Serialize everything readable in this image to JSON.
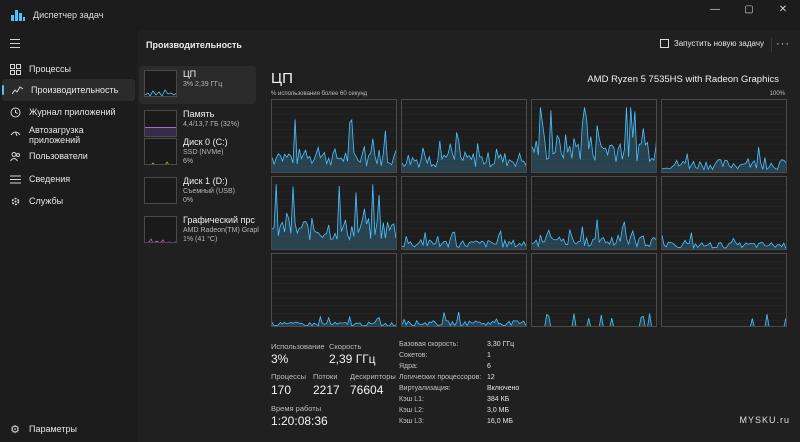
{
  "window": {
    "title": "Диспетчер задач",
    "controls": [
      "—",
      "▢",
      "✕"
    ]
  },
  "nav": {
    "items": [
      {
        "label": "Процессы",
        "icon": "grid-icon"
      },
      {
        "label": "Производительность",
        "icon": "performance-icon"
      },
      {
        "label": "Журнал приложений",
        "icon": "history-icon"
      },
      {
        "label": "Автозагрузка приложений",
        "icon": "startup-icon"
      },
      {
        "label": "Пользователи",
        "icon": "users-icon"
      },
      {
        "label": "Сведения",
        "icon": "details-icon"
      },
      {
        "label": "Службы",
        "icon": "services-icon"
      }
    ],
    "settings_label": "Параметры"
  },
  "header": {
    "title": "Производительность",
    "run_task_label": "Запустить новую задачу",
    "more_label": "···"
  },
  "devices": [
    {
      "name": "ЦП",
      "sub1": "3%  2,39 ГГц",
      "sub2": "",
      "color": "#4cc2ff"
    },
    {
      "name": "Память",
      "sub1": "4,4/13,7 ГБ (32%)",
      "sub2": "",
      "color": "#a070d0"
    },
    {
      "name": "Диск 0 (C:)",
      "sub1": "SSD (NVMe)",
      "sub2": "6%",
      "color": "#7fbf3f"
    },
    {
      "name": "Диск 1 (D:)",
      "sub1": "Съемный (USB)",
      "sub2": "0%",
      "color": "#7fbf3f"
    },
    {
      "name": "Графический прс",
      "sub1": "AMD Radeon(TM) Grapl",
      "sub2": "1%  (41 °C)",
      "color": "#c060c0"
    }
  ],
  "cpu": {
    "title": "ЦП",
    "model": "AMD Ryzen 5 7535HS with Radeon Graphics",
    "axis_label": "% использования более 60 секунд",
    "axis_max": "100%",
    "graph_color": "#4cc2ff",
    "core_levels": [
      0.35,
      0.3,
      0.55,
      0.2,
      0.45,
      0.15,
      0.2,
      0.12,
      0.08,
      0.1,
      0.03,
      0.02
    ]
  },
  "stats": {
    "usage_label": "Использование",
    "usage_value": "3%",
    "speed_label": "Скорость",
    "speed_value": "2,39 ГГц",
    "processes_label": "Процессы",
    "processes_value": "170",
    "threads_label": "Потоки",
    "threads_value": "2217",
    "handles_label": "Дескрипторы",
    "handles_value": "76604",
    "uptime_label": "Время работы",
    "uptime_value": "1:20:08:36"
  },
  "specs": [
    {
      "label": "Базовая скорость:",
      "value": "3,30 ГГц"
    },
    {
      "label": "Сокетов:",
      "value": "1"
    },
    {
      "label": "Ядра:",
      "value": "6"
    },
    {
      "label": "Логических процессоров:",
      "value": "12"
    },
    {
      "label": "Виртуализация:",
      "value": "Включено"
    },
    {
      "label": "Кэш L1:",
      "value": "384 КБ"
    },
    {
      "label": "Кэш L2:",
      "value": "3,0 МБ"
    },
    {
      "label": "Кэш L3:",
      "value": "16,0 МБ"
    }
  ],
  "watermark": {
    "main": "MYSKU",
    "suffix": ".ru"
  }
}
